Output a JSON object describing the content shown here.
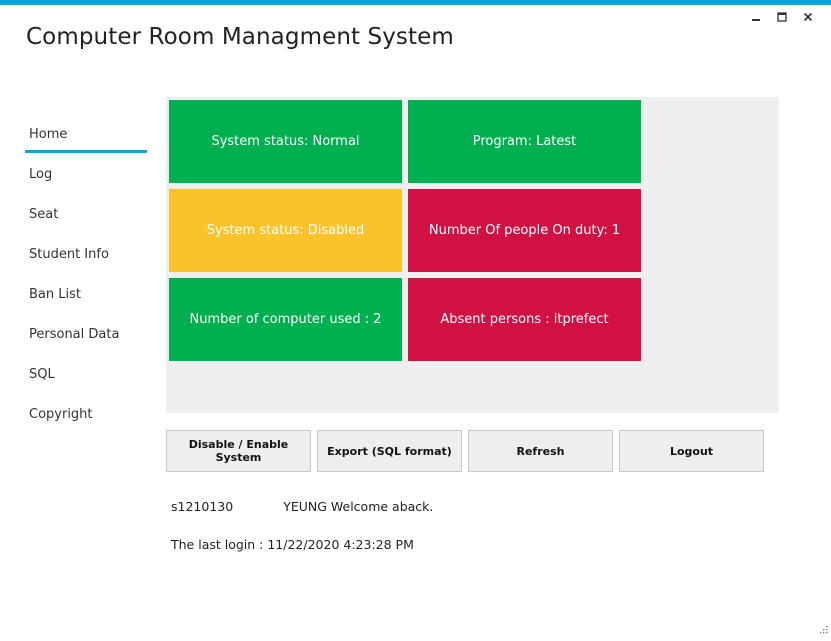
{
  "window": {
    "title": "Computer Room Managment System",
    "accent_color": "#0ca5d6",
    "controls": [
      "minimize-icon",
      "maximize-icon",
      "close-icon"
    ]
  },
  "sidebar": {
    "items": [
      {
        "label": "Home",
        "active": true
      },
      {
        "label": "Log"
      },
      {
        "label": "Seat"
      },
      {
        "label": "Student Info"
      },
      {
        "label": "Ban List"
      },
      {
        "label": "Personal Data"
      },
      {
        "label": "SQL"
      },
      {
        "label": "Copyright"
      }
    ]
  },
  "tiles": [
    {
      "label": "System status: Normal",
      "color": "#00b050"
    },
    {
      "label": "Program: Latest",
      "color": "#00b050"
    },
    {
      "label": "System status: Disabled",
      "color": "#fbc32a"
    },
    {
      "label": "Number Of people On duty: 1",
      "color": "#d11143"
    },
    {
      "label": "Number of computer used : 2",
      "color": "#00b050"
    },
    {
      "label": "Absent persons : itprefect",
      "color": "#d11143"
    }
  ],
  "buttons": {
    "toggle_system": "Disable / Enable System",
    "export_sql": "Export (SQL format)",
    "refresh": "Refresh",
    "logout": "Logout"
  },
  "user": {
    "id": "s1210130",
    "welcome": "YEUNG Welcome aback.",
    "last_login": "The last login : 11/22/2020 4:23:28 PM"
  }
}
